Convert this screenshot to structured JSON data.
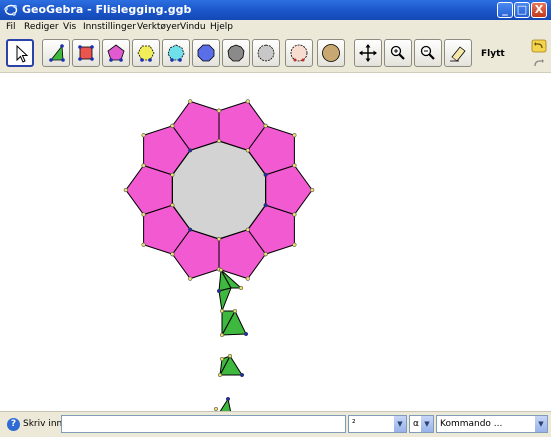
{
  "window": {
    "title": "GeoGebra - Flislegging.ggb",
    "minimize_symbol": "_",
    "maximize_symbol": "□",
    "close_symbol": "X"
  },
  "menu": [
    "Fil",
    "Rediger",
    "Vis",
    "Innstillinger",
    "Verktøyer",
    "Vindu",
    "Hjelp"
  ],
  "toolbar": {
    "tools": [
      {
        "name": "move-tool",
        "icon": "cursor-arrow-icon",
        "active": true
      },
      {
        "name": "vector-tool",
        "icon": "triangle-tool-icon"
      },
      {
        "name": "polygon-tool",
        "icon": "red-square-icon"
      },
      {
        "name": "regular-pentagon-tool",
        "icon": "pink-pentagon-icon"
      },
      {
        "name": "regular-hexagon-tool",
        "icon": "yellow-hexagon-icon"
      },
      {
        "name": "regular-heptagon-tool",
        "icon": "cyan-heptagon-icon"
      },
      {
        "name": "regular-octagon-tool",
        "icon": "blue-octagon-icon"
      },
      {
        "name": "regular-nonagon-tool",
        "icon": "gray-nonagon-icon"
      },
      {
        "name": "regular-decagon-tool",
        "icon": "silver-decagon-icon"
      },
      {
        "name": "circle-polygon-tool",
        "icon": "peach-polygon-icon"
      },
      {
        "name": "tan-polygon-tool",
        "icon": "tan-dodecagon-icon"
      },
      {
        "name": "move-view-tool",
        "icon": "move-arrows-icon"
      },
      {
        "name": "zoom-in-tool",
        "icon": "zoom-in-icon"
      },
      {
        "name": "zoom-out-tool",
        "icon": "zoom-out-icon"
      },
      {
        "name": "delete-tool",
        "icon": "eraser-icon"
      }
    ],
    "current_tool_name": "Flytt",
    "side_icons": [
      "undo-icon",
      "redo-icon"
    ]
  },
  "input_bar": {
    "label": "Skriv inn:",
    "value": "",
    "exponent_combo": "²",
    "greek_combo": "α",
    "command_combo": "Kommando ...",
    "dropdown_symbol": "▼"
  },
  "colors": {
    "pentagon_fill": "#f25ad1",
    "center_fill": "#d3d3d3",
    "stem_fill": "#3fb83f",
    "point_fill": "#e8e070",
    "point_blue": "#1c2fb0"
  }
}
